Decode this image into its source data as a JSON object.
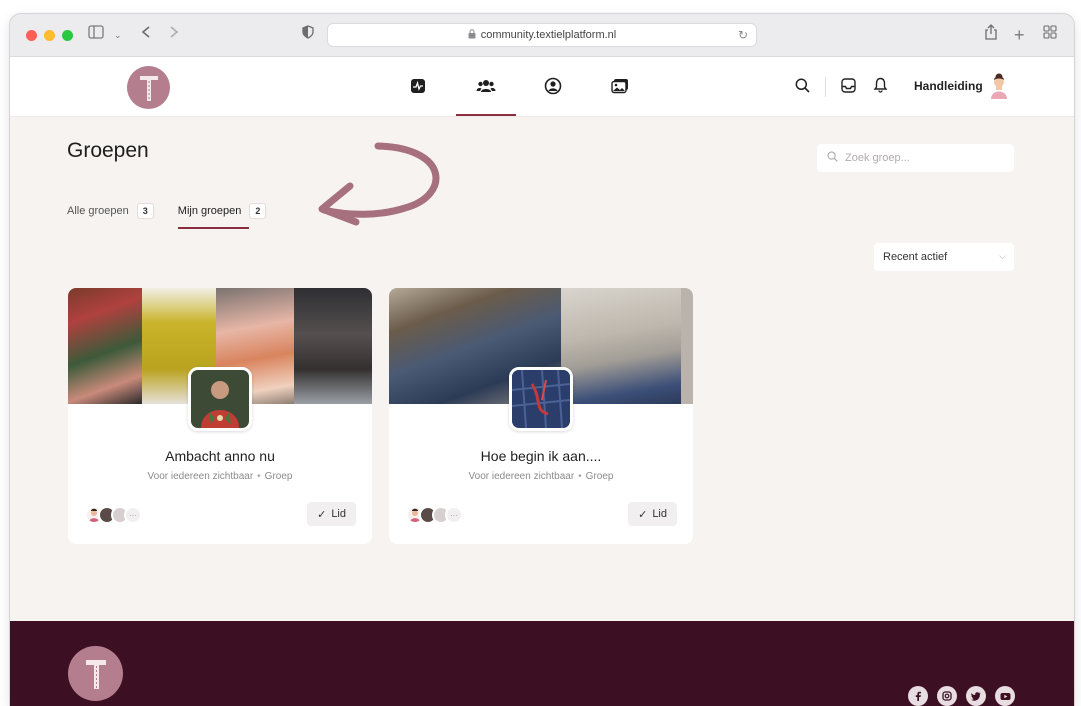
{
  "browser": {
    "url": "community.textielplatform.nl"
  },
  "header": {
    "nav_items": [
      {
        "icon": "activity-icon"
      },
      {
        "icon": "groups-icon"
      },
      {
        "icon": "profile-icon"
      },
      {
        "icon": "media-icon"
      }
    ],
    "handleiding_label": "Handleiding"
  },
  "page": {
    "title": "Groepen",
    "search_placeholder": "Zoek groep...",
    "tabs": [
      {
        "label": "Alle groepen",
        "count": "3"
      },
      {
        "label": "Mijn groepen",
        "count": "2"
      }
    ],
    "sort_label": "Recent actief"
  },
  "groups": [
    {
      "name": "Ambacht anno nu",
      "visibility": "Voor iedereen zichtbaar",
      "type": "Groep",
      "member_button": "Lid",
      "more": "···"
    },
    {
      "name": "Hoe begin ik aan....",
      "visibility": "Voor iedereen zichtbaar",
      "type": "Groep",
      "member_button": "Lid",
      "more": "···"
    }
  ],
  "colors": {
    "accent": "#8a2e3f",
    "logo_bg": "#b57e8e",
    "footer_bg": "#3d0f23",
    "page_bg": "#f7f3f1"
  }
}
